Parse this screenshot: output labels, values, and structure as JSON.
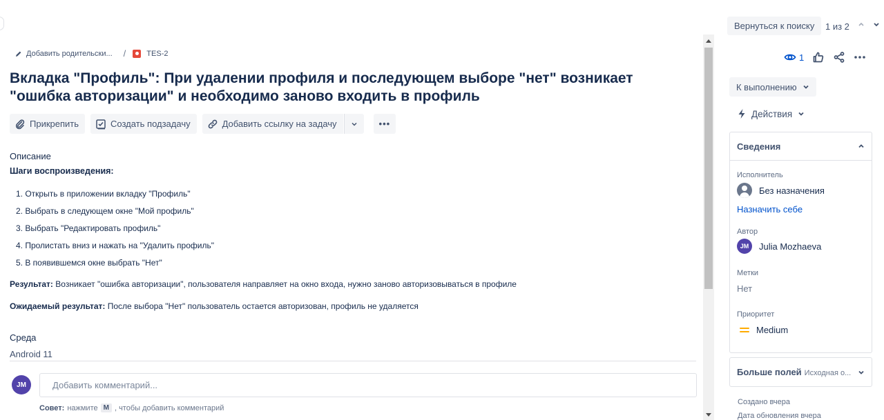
{
  "breadcrumb": {
    "add_parent": "Добавить родительски...",
    "separator": "/",
    "issue_key": "TES-2"
  },
  "issue": {
    "title": "Вкладка \"Профиль\": При удалении профиля и последующем выборе \"нет\" возникает \"ошибка авторизации\" и необходимо заново входить в профиль"
  },
  "toolbar": {
    "attach": "Прикрепить",
    "create_subtask": "Создать подзадачу",
    "link_issue": "Добавить ссылку на задачу",
    "more": "•••"
  },
  "description": {
    "label": "Описание",
    "steps_heading": "Шаги воспроизведения:",
    "steps": [
      "1. Открыть в приложении вкладку \"Профиль\"",
      "2. Выбрать в следующем окне \"Мой профиль\"",
      "3. Выбрать \"Редактировать профиль\"",
      "4. Пролистать вниз и нажать на \"Удалить профиль\"",
      "5. В появившемся окне выбрать \"Нет\""
    ],
    "result_label": "Результат:",
    "result_text": " Возникает \"ошибка авторизации\", пользователя направляет на окно входа, нужно заново авторизовываться в профиле",
    "expected_label": "Ожидаемый результат:",
    "expected_text": " После выбора \"Нет\" пользователь остается авторизован, профиль не удаляется"
  },
  "environment": {
    "label": "Среда",
    "value": "Android 11"
  },
  "comment": {
    "avatar_initials": "JM",
    "placeholder": "Добавить комментарий...",
    "tip_label": "Совет:",
    "tip_pre": "нажмите",
    "tip_key": "M",
    "tip_post": ", чтобы добавить комментарий"
  },
  "nav": {
    "back_to_search": "Вернуться к поиску",
    "position": "1 из 2",
    "prev_icon": "chevron-up-icon",
    "next_icon": "chevron-down-icon"
  },
  "side": {
    "watchers_count": "1",
    "status": "К выполнению",
    "actions": "Действия",
    "details": {
      "title": "Сведения",
      "assignee_label": "Исполнитель",
      "assignee_value": "Без назначения",
      "assign_self": "Назначить себе",
      "reporter_label": "Автор",
      "reporter_initials": "JM",
      "reporter_value": "Julia Mozhaeva",
      "labels_label": "Метки",
      "labels_value": "Нет",
      "priority_label": "Приоритет",
      "priority_value": "Medium"
    },
    "more_fields": {
      "title": "Больше полей",
      "hint": "Исходная о..."
    },
    "created": "Создано вчера",
    "updated": "Дата обновления вчера"
  },
  "colors": {
    "accent": "#0052cc",
    "bug": "#e5493a",
    "avatar": "#5243aa",
    "priority_medium": "#ffab00"
  }
}
